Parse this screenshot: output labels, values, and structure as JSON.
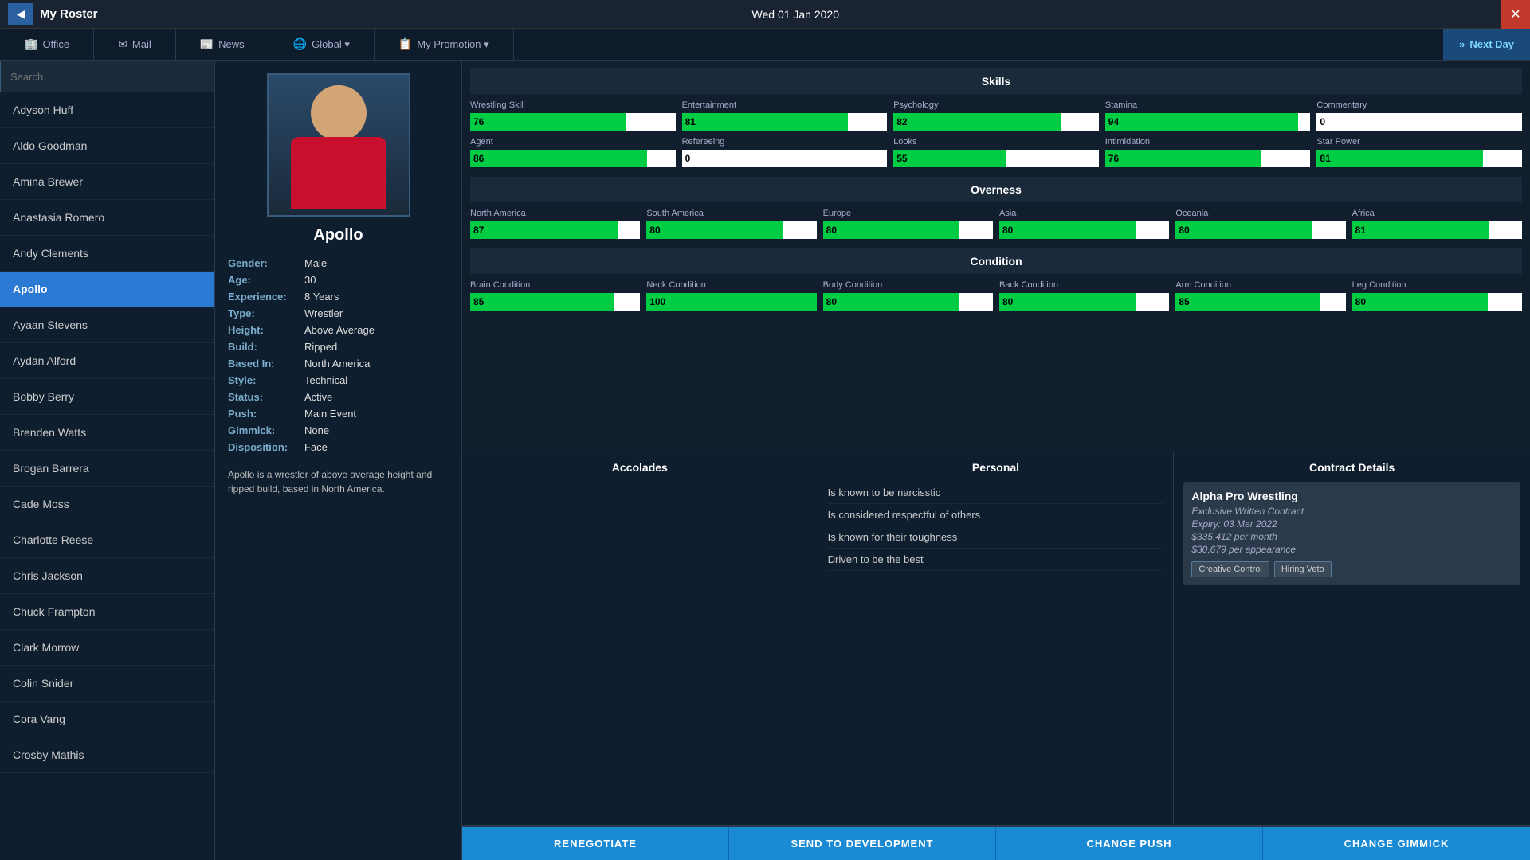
{
  "titleBar": {
    "title": "My Roster",
    "date": "Wed 01 Jan 2020",
    "backLabel": "◀",
    "closeLabel": "✕"
  },
  "nav": {
    "items": [
      {
        "label": "Office",
        "icon": "🏢"
      },
      {
        "label": "Mail",
        "icon": "✉"
      },
      {
        "label": "News",
        "icon": "📰"
      },
      {
        "label": "Global ▾",
        "icon": "🌐"
      },
      {
        "label": "My Promotion ▾",
        "icon": "📋"
      }
    ],
    "nextDay": "Next Day"
  },
  "search": {
    "placeholder": "Search"
  },
  "roster": [
    {
      "name": "Adyson Huff"
    },
    {
      "name": "Aldo Goodman"
    },
    {
      "name": "Amina Brewer"
    },
    {
      "name": "Anastasia Romero"
    },
    {
      "name": "Andy Clements"
    },
    {
      "name": "Apollo",
      "active": true
    },
    {
      "name": "Ayaan Stevens"
    },
    {
      "name": "Aydan Alford"
    },
    {
      "name": "Bobby Berry"
    },
    {
      "name": "Brenden Watts"
    },
    {
      "name": "Brogan Barrera"
    },
    {
      "name": "Cade Moss"
    },
    {
      "name": "Charlotte Reese"
    },
    {
      "name": "Chris Jackson"
    },
    {
      "name": "Chuck Frampton"
    },
    {
      "name": "Clark Morrow"
    },
    {
      "name": "Colin Snider"
    },
    {
      "name": "Cora Vang"
    },
    {
      "name": "Crosby Mathis"
    }
  ],
  "wrestler": {
    "name": "Apollo",
    "gender": "Male",
    "age": 30,
    "experience": "8 Years",
    "type": "Wrestler",
    "height": "Above Average",
    "build": "Ripped",
    "basedIn": "North America",
    "style": "Technical",
    "status": "Active",
    "push": "Main Event",
    "gimmick": "None",
    "disposition": "Face",
    "bio": "Apollo is a wrestler of above average height and ripped build, based in North America."
  },
  "skills": {
    "label": "Skills",
    "items": [
      {
        "label": "Wrestling Skill",
        "value": 76,
        "pct": 76
      },
      {
        "label": "Entertainment",
        "value": 81,
        "pct": 81
      },
      {
        "label": "Psychology",
        "value": 82,
        "pct": 82
      },
      {
        "label": "Stamina",
        "value": 94,
        "pct": 94
      },
      {
        "label": "Commentary",
        "value": 0,
        "pct": 0
      },
      {
        "label": "Agent",
        "value": 86,
        "pct": 86
      },
      {
        "label": "Refereeing",
        "value": 0,
        "pct": 0
      },
      {
        "label": "Looks",
        "value": 55,
        "pct": 55
      },
      {
        "label": "Intimidation",
        "value": 76,
        "pct": 76
      },
      {
        "label": "Star Power",
        "value": 81,
        "pct": 81
      }
    ]
  },
  "overness": {
    "label": "Overness",
    "items": [
      {
        "label": "North America",
        "value": 87,
        "pct": 87
      },
      {
        "label": "South America",
        "value": 80,
        "pct": 80
      },
      {
        "label": "Europe",
        "value": 80,
        "pct": 80
      },
      {
        "label": "Asia",
        "value": 80,
        "pct": 80
      },
      {
        "label": "Oceania",
        "value": 80,
        "pct": 80
      },
      {
        "label": "Africa",
        "value": 81,
        "pct": 81
      }
    ]
  },
  "condition": {
    "label": "Condition",
    "items": [
      {
        "label": "Brain Condition",
        "value": 85,
        "pct": 85
      },
      {
        "label": "Neck Condition",
        "value": 100,
        "pct": 100
      },
      {
        "label": "Body Condition",
        "value": 80,
        "pct": 80
      },
      {
        "label": "Back Condition",
        "value": 80,
        "pct": 80
      },
      {
        "label": "Arm Condition",
        "value": 85,
        "pct": 85
      },
      {
        "label": "Leg Condition",
        "value": 80,
        "pct": 80
      }
    ]
  },
  "accolades": {
    "label": "Accolades"
  },
  "personal": {
    "label": "Personal",
    "traits": [
      "Is known to be narcisstic",
      "Is considered respectful of others",
      "Is known for their toughness",
      "Driven to be the best"
    ]
  },
  "contract": {
    "label": "Contract Details",
    "promotion": "Alpha Pro Wrestling",
    "type": "Exclusive Written Contract",
    "expiry": "Expiry: 03 Mar 2022",
    "perMonth": "$335,412 per month",
    "perAppearance": "$30,679 per appearance",
    "tags": [
      "Creative Control",
      "Hiring Veto"
    ]
  },
  "actions": {
    "renegotiate": "RENEGOTIATE",
    "sendToDev": "SEND TO DEVELOPMENT",
    "changePush": "CHANGE PUSH",
    "changeGimmick": "CHANGE GIMMICK"
  }
}
